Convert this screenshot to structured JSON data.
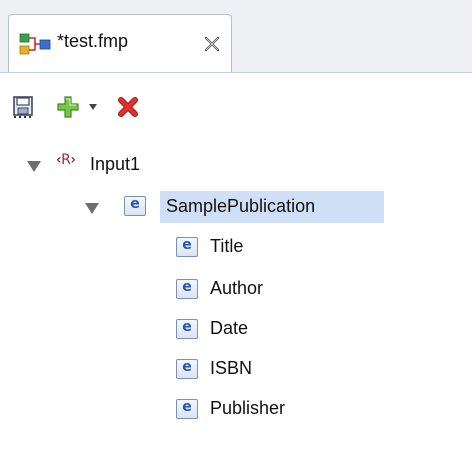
{
  "editor": {
    "tab": {
      "title": "*test.fmp",
      "icon": "mapping-file-icon",
      "close_icon": "close-icon"
    }
  },
  "toolbar": {
    "items": [
      {
        "name": "save",
        "icon": "save-icon"
      },
      {
        "name": "add",
        "icon": "add-icon",
        "has_dropdown": true
      },
      {
        "name": "delete",
        "icon": "delete-icon"
      }
    ]
  },
  "tree": {
    "root": {
      "label": "Input1",
      "badge": "R",
      "expanded": true,
      "children": [
        {
          "label": "SamplePublication",
          "badge": "e",
          "expanded": true,
          "selected": true,
          "children": [
            {
              "label": "Title",
              "badge": "e"
            },
            {
              "label": "Author",
              "badge": "e"
            },
            {
              "label": "Date",
              "badge": "e"
            },
            {
              "label": "ISBN",
              "badge": "e"
            },
            {
              "label": "Publisher",
              "badge": "e"
            }
          ]
        }
      ]
    }
  },
  "colors": {
    "selection": "#cfe0f6",
    "element_badge": "#2a55b0",
    "root_badge": "#b0281f",
    "add_green": "#5aa832",
    "delete_red": "#d0241e"
  }
}
